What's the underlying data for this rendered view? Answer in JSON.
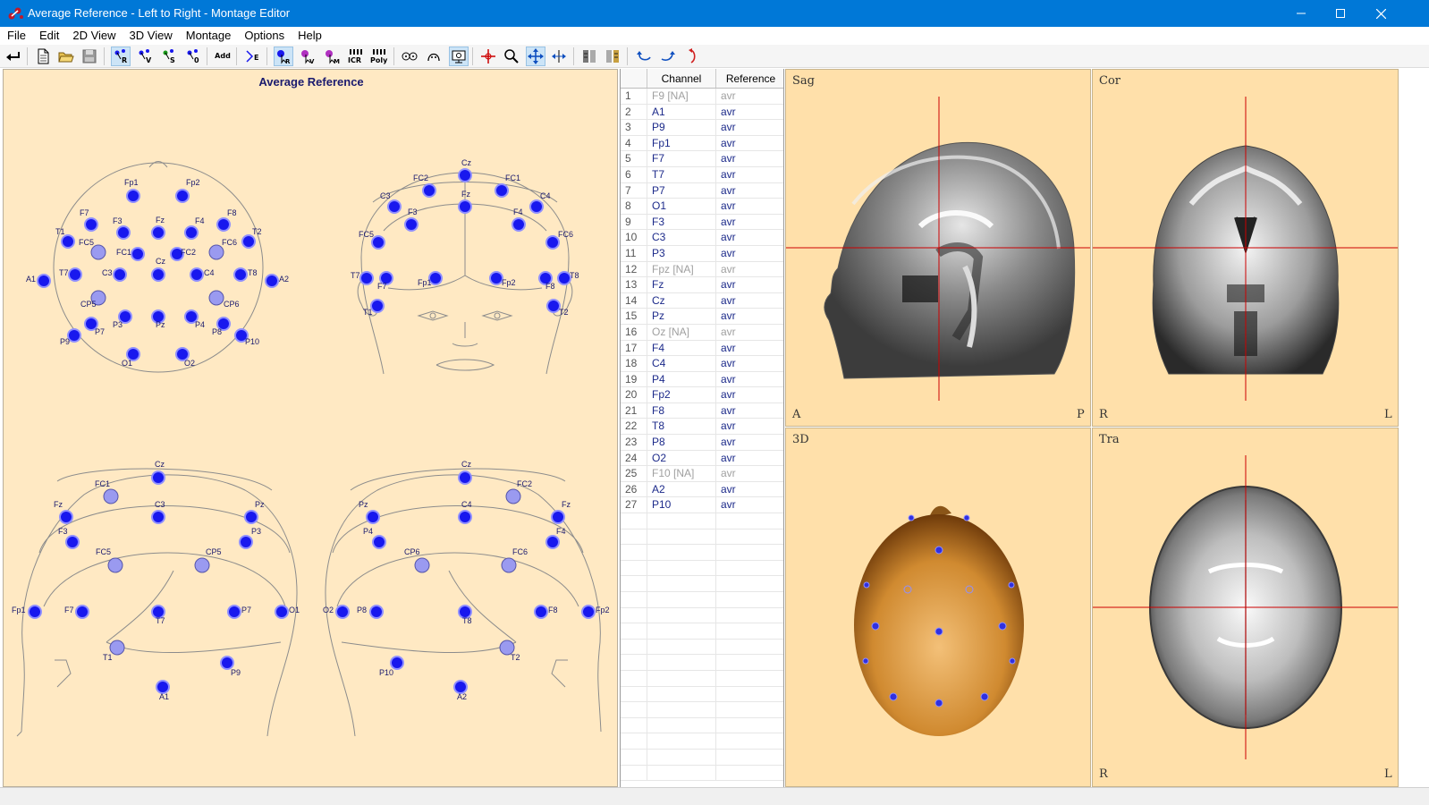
{
  "window": {
    "title": "Average Reference - Left to Right - Montage Editor"
  },
  "menu": [
    {
      "label": "File"
    },
    {
      "label": "Edit"
    },
    {
      "label": "2D View"
    },
    {
      "label": "3D View"
    },
    {
      "label": "Montage"
    },
    {
      "label": "Options"
    },
    {
      "label": "Help"
    }
  ],
  "toolbar": {
    "add_label": "Add",
    "icr_label": "ICR",
    "poly_label": "Poly",
    "e_label": "E"
  },
  "montage_panel": {
    "title": "Average Reference"
  },
  "electrodes": {
    "top": [
      "Fp1",
      "Fp2",
      "F7",
      "F3",
      "Fz",
      "F4",
      "F8",
      "T1",
      "T2",
      "FC5",
      "FC1",
      "FC2",
      "FC6",
      "A1",
      "T7",
      "C3",
      "Cz",
      "C4",
      "T8",
      "A2",
      "CP5",
      "CP6",
      "P7",
      "P3",
      "Pz",
      "P4",
      "P8",
      "P9",
      "P10",
      "O1",
      "O2"
    ],
    "front": [
      "Cz",
      "FC2",
      "FC1",
      "C4",
      "C3",
      "Fz",
      "F4",
      "F3",
      "FC6",
      "FC5",
      "T8",
      "F8",
      "Fp2",
      "Fp1",
      "F7",
      "T7",
      "T2",
      "T1"
    ],
    "left": [
      "Cz",
      "FC1",
      "C3",
      "Fz",
      "Pz",
      "F3",
      "P3",
      "FC5",
      "CP5",
      "Fp1",
      "F7",
      "T7",
      "P7",
      "O1",
      "T1",
      "P9",
      "A1"
    ],
    "right": [
      "Cz",
      "FC2",
      "C4",
      "Pz",
      "Fz",
      "P4",
      "F4",
      "CP6",
      "FC6",
      "O2",
      "P8",
      "T8",
      "F8",
      "Fp2",
      "T2",
      "P10",
      "A2"
    ]
  },
  "channel_table": {
    "headers": {
      "index": "",
      "channel": "Channel",
      "reference": "Reference"
    },
    "rows": [
      {
        "idx": "1",
        "channel": "F9  [NA]",
        "ref": "avr",
        "na": true
      },
      {
        "idx": "2",
        "channel": "A1",
        "ref": "avr"
      },
      {
        "idx": "3",
        "channel": "P9",
        "ref": "avr"
      },
      {
        "idx": "4",
        "channel": "Fp1",
        "ref": "avr"
      },
      {
        "idx": "5",
        "channel": "F7",
        "ref": "avr"
      },
      {
        "idx": "6",
        "channel": "T7",
        "ref": "avr"
      },
      {
        "idx": "7",
        "channel": "P7",
        "ref": "avr"
      },
      {
        "idx": "8",
        "channel": "O1",
        "ref": "avr"
      },
      {
        "idx": "9",
        "channel": "F3",
        "ref": "avr"
      },
      {
        "idx": "10",
        "channel": "C3",
        "ref": "avr"
      },
      {
        "idx": "11",
        "channel": "P3",
        "ref": "avr"
      },
      {
        "idx": "12",
        "channel": "Fpz  [NA]",
        "ref": "avr",
        "na": true
      },
      {
        "idx": "13",
        "channel": "Fz",
        "ref": "avr"
      },
      {
        "idx": "14",
        "channel": "Cz",
        "ref": "avr"
      },
      {
        "idx": "15",
        "channel": "Pz",
        "ref": "avr"
      },
      {
        "idx": "16",
        "channel": "Oz  [NA]",
        "ref": "avr",
        "na": true
      },
      {
        "idx": "17",
        "channel": "F4",
        "ref": "avr"
      },
      {
        "idx": "18",
        "channel": "C4",
        "ref": "avr"
      },
      {
        "idx": "19",
        "channel": "P4",
        "ref": "avr"
      },
      {
        "idx": "20",
        "channel": "Fp2",
        "ref": "avr"
      },
      {
        "idx": "21",
        "channel": "F8",
        "ref": "avr"
      },
      {
        "idx": "22",
        "channel": "T8",
        "ref": "avr"
      },
      {
        "idx": "23",
        "channel": "P8",
        "ref": "avr"
      },
      {
        "idx": "24",
        "channel": "O2",
        "ref": "avr"
      },
      {
        "idx": "25",
        "channel": "F10  [NA]",
        "ref": "avr",
        "na": true
      },
      {
        "idx": "26",
        "channel": "A2",
        "ref": "avr"
      },
      {
        "idx": "27",
        "channel": "P10",
        "ref": "avr"
      }
    ]
  },
  "views": {
    "sag": {
      "label": "Sag",
      "left": "A",
      "right": "P"
    },
    "cor": {
      "label": "Cor",
      "left": "R",
      "right": "L"
    },
    "three_d": {
      "label": "3D"
    },
    "tra": {
      "label": "Tra",
      "left": "R",
      "right": "L"
    }
  },
  "colors": {
    "electrode_fill": "#1818ee",
    "electrode_light": "#9a9af0",
    "panel_bg": "#ffe9c3",
    "view_bg": "#ffe0aa",
    "crosshair": "#cc0000",
    "titlebar": "#0078d7"
  }
}
